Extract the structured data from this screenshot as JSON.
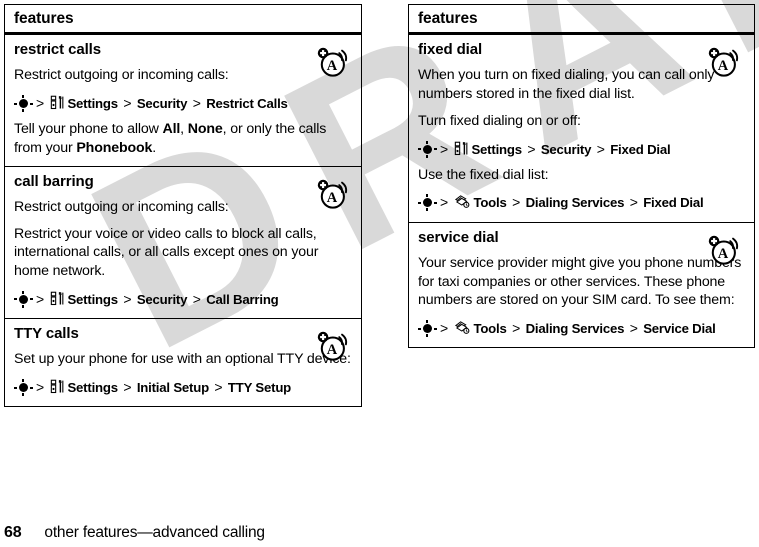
{
  "page": {
    "number": "68",
    "footer_text": "other features—advanced calling",
    "watermark": "DRAFT",
    "watermark_color": "#d9d9d9"
  },
  "left_column": {
    "header": "features",
    "rows": [
      {
        "title": "restrict calls",
        "icon": "antenna-a-icon",
        "blocks": [
          {
            "type": "para",
            "text": "Restrict outgoing or incoming calls:"
          },
          {
            "type": "path",
            "key_icon": "nav-key-icon",
            "menu_icon": "settings-tools-icon",
            "items": [
              "Settings",
              "Security",
              "Restrict Calls"
            ]
          },
          {
            "type": "para_rich",
            "runs": [
              {
                "t": "Tell your phone to allow ",
                "b": false
              },
              {
                "t": "All",
                "b": true
              },
              {
                "t": ", ",
                "b": false
              },
              {
                "t": "None",
                "b": true
              },
              {
                "t": ", or only the calls from your ",
                "b": false
              },
              {
                "t": "Phonebook",
                "b": true
              },
              {
                "t": ".",
                "b": false
              }
            ]
          }
        ]
      },
      {
        "title": "call barring",
        "icon": "antenna-a-icon",
        "blocks": [
          {
            "type": "para",
            "text": "Restrict outgoing or incoming calls:"
          },
          {
            "type": "para",
            "text": "Restrict your voice or video calls to block all calls, international calls, or all calls except ones on your home network."
          },
          {
            "type": "path",
            "key_icon": "nav-key-icon",
            "menu_icon": "settings-tools-icon",
            "items": [
              "Settings",
              "Security",
              "Call Barring"
            ]
          }
        ]
      },
      {
        "title": "TTY calls",
        "icon": "antenna-a-icon",
        "blocks": [
          {
            "type": "para",
            "text": "Set up your phone for use with an optional TTY device:"
          },
          {
            "type": "path",
            "key_icon": "nav-key-icon",
            "menu_icon": "settings-tools-icon",
            "items": [
              "Settings",
              "Initial Setup",
              "TTY Setup"
            ]
          }
        ]
      }
    ]
  },
  "right_column": {
    "header": "features",
    "rows": [
      {
        "title": "fixed dial",
        "icon": "antenna-a-icon",
        "blocks": [
          {
            "type": "para",
            "text": "When you turn on fixed dialing, you can call only numbers stored in the fixed dial list."
          },
          {
            "type": "para",
            "text": "Turn fixed dialing on or off:"
          },
          {
            "type": "path",
            "key_icon": "nav-key-icon",
            "menu_icon": "settings-tools-icon",
            "items": [
              "Settings",
              "Security",
              "Fixed Dial"
            ]
          },
          {
            "type": "para",
            "text": "Use the fixed dial list:"
          },
          {
            "type": "path",
            "key_icon": "nav-key-icon",
            "menu_icon": "tools-cards-icon",
            "items": [
              "Tools",
              "Dialing Services",
              "Fixed Dial"
            ]
          }
        ]
      },
      {
        "title": "service dial",
        "icon": "antenna-a-icon",
        "blocks": [
          {
            "type": "para",
            "text": "Your service provider might give you phone numbers for taxi companies or other services. These phone numbers are stored on your SIM card. To see them:"
          },
          {
            "type": "path",
            "key_icon": "nav-key-icon",
            "menu_icon": "tools-cards-icon",
            "items": [
              "Tools",
              "Dialing Services",
              "Service Dial"
            ]
          }
        ]
      }
    ]
  },
  "separator": ">"
}
